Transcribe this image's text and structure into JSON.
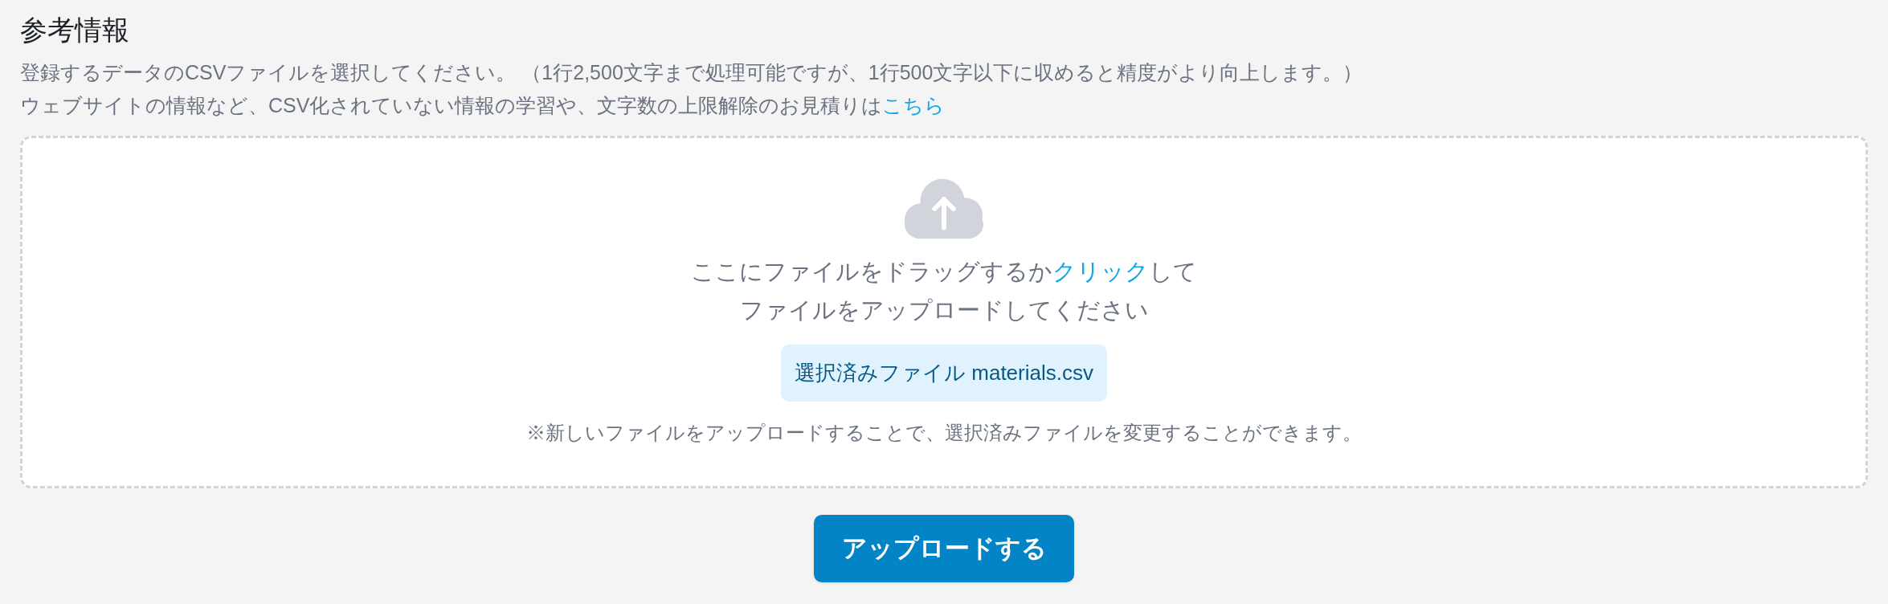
{
  "section": {
    "title": "参考情報",
    "description": {
      "line_1": "登録するデータのCSVファイルを選択してください。 （1行2,500文字まで処理可能ですが、1行500文字以下に収めると精度がより向上します。）",
      "line_2": "ウェブサイトの情報など、CSV化されていない情報の学習や、文字数の上限解除のお見積りは",
      "link": "こちら"
    }
  },
  "dropzone": {
    "prompt": {
      "before_link": "ここにファイルをドラッグするか",
      "link": "クリック",
      "after_link": "して",
      "second_line": "ファイルをアップロードしてください"
    },
    "selected_file": {
      "label": "選択済みファイル",
      "file_name": "materials.csv"
    },
    "note": "※新しいファイルをアップロードすることで、選択済みファイルを変更することができます。"
  },
  "upload_button": {
    "label": "アップロードする"
  }
}
